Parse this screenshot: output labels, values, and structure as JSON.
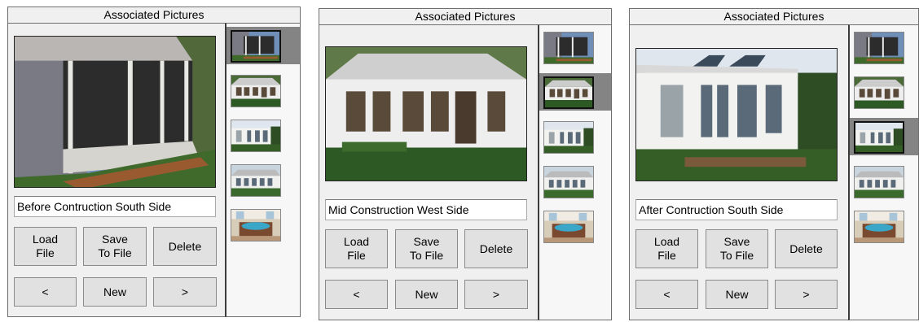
{
  "colors": {
    "panel_bg": "#f0f0f0",
    "selected_band": "#848484",
    "button_bg": "#e1e1e1",
    "border": "#6e6e6e"
  },
  "panels": [
    {
      "title": "Associated Pictures",
      "caption": "Before Contruction South Side",
      "selected_index": 0,
      "buttons": {
        "load": "Load\nFile",
        "save": "Save\nTo File",
        "delete": "Delete",
        "prev": "<",
        "new": "New",
        "next": ">"
      }
    },
    {
      "title": "Associated Pictures",
      "caption": "Mid Construction West Side",
      "selected_index": 1,
      "buttons": {
        "load": "Load\nFile",
        "save": "Save\nTo File",
        "delete": "Delete",
        "prev": "<",
        "new": "New",
        "next": ">"
      }
    },
    {
      "title": "Associated Pictures",
      "caption": "After Contruction South Side",
      "selected_index": 2,
      "buttons": {
        "load": "Load\nFile",
        "save": "Save\nTo File",
        "delete": "Delete",
        "prev": "<",
        "new": "New",
        "next": ">"
      }
    }
  ],
  "thumbnails": [
    {
      "name": "screened-porch-thumbnail"
    },
    {
      "name": "sunroom-framing-thumbnail"
    },
    {
      "name": "sunroom-finished-thumbnail"
    },
    {
      "name": "sunroom-exterior-thumbnail"
    },
    {
      "name": "hot-tub-interior-thumbnail"
    }
  ]
}
